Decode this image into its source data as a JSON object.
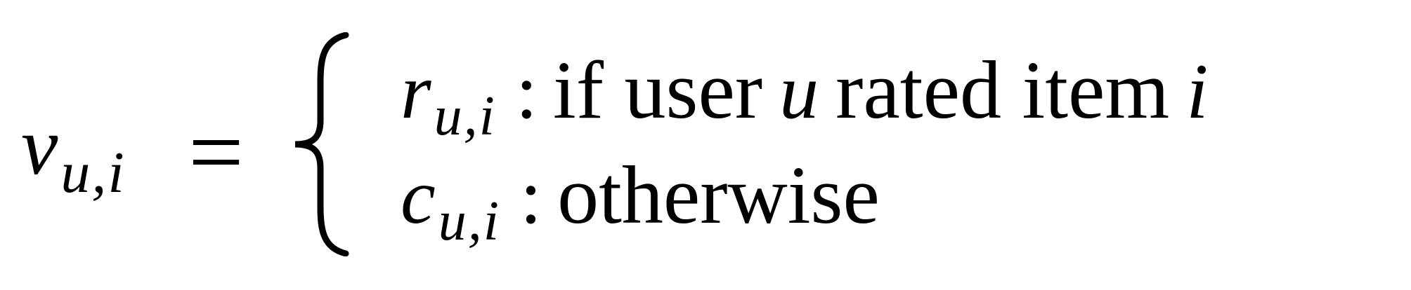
{
  "equation": {
    "lhs": {
      "variable": "v",
      "subscript": "u,i"
    },
    "equals": "=",
    "cases": [
      {
        "variable": "r",
        "subscript": "u,i",
        "colon": ":",
        "text_before": "if user",
        "inline_var_1": "u",
        "text_middle": "rated item",
        "inline_var_2": "i"
      },
      {
        "variable": "c",
        "subscript": "u,i",
        "colon": ":",
        "text": "otherwise"
      }
    ]
  }
}
